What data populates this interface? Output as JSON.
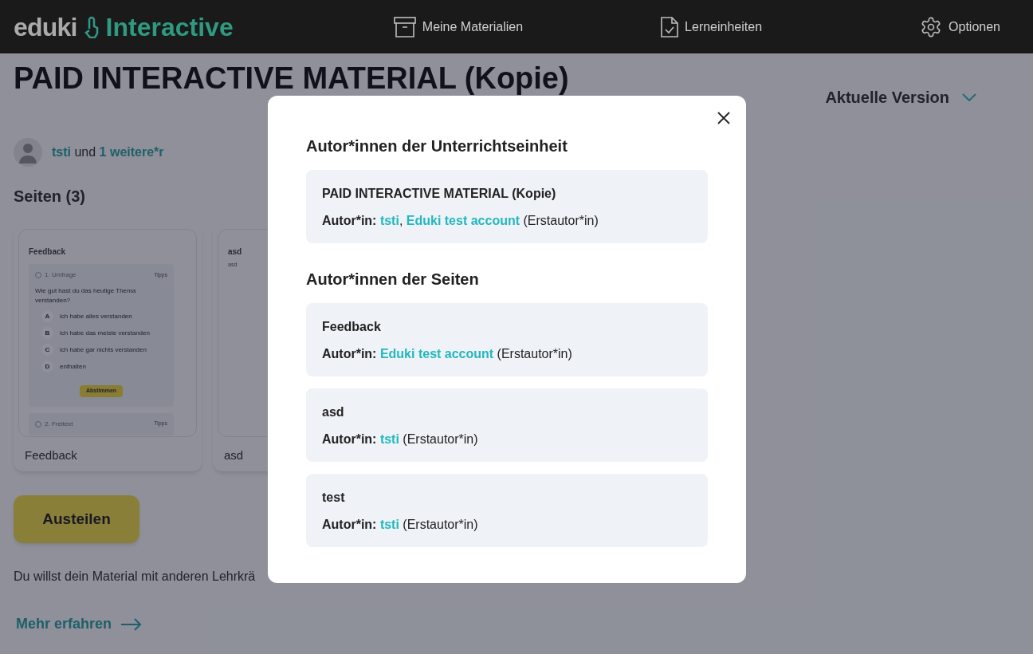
{
  "header": {
    "brand": "eduki",
    "product": "Interactive",
    "nav": [
      {
        "label": "Meine Materialien"
      },
      {
        "label": "Lerneinheiten"
      },
      {
        "label": "Optionen"
      }
    ]
  },
  "page": {
    "title": "PAID INTERACTIVE MATERIAL (Kopie)",
    "authors": {
      "first": "tsti",
      "joiner": "und",
      "more": "1 weitere*r"
    },
    "version_select": "Aktuelle Version",
    "pages_heading": "Seiten (3)",
    "pages": [
      {
        "caption": "Feedback",
        "preview": {
          "title": "Feedback",
          "blocks": [
            {
              "title": "1. Umfrage",
              "tips": "Tipps",
              "question": "Wie gut hast du das heutige Thema verstanden?",
              "options": [
                {
                  "letter": "A",
                  "text": "ich habe alles verstanden"
                },
                {
                  "letter": "B",
                  "text": "ich habe das meiste verstanden"
                },
                {
                  "letter": "C",
                  "text": "ich habe gar nichts verstanden"
                },
                {
                  "letter": "D",
                  "text": "enthalten"
                }
              ],
              "button": "Abstimmen"
            },
            {
              "title": "2. Freitext",
              "tips": "Tipps"
            }
          ]
        }
      },
      {
        "caption": "asd",
        "preview": {
          "title": "asd",
          "body": "asd"
        }
      }
    ],
    "share_button": "Austeilen",
    "share_text": "Du willst dein Material mit anderen Lehrkrä",
    "more_link": "Mehr erfahren"
  },
  "modal": {
    "sections": [
      {
        "heading": "Autor*innen der Unterrichtseinheit",
        "items": [
          {
            "title": "PAID INTERACTIVE MATERIAL (Kopie)",
            "label": "Autor*in:",
            "authors": [
              "tsti",
              "Eduki test account"
            ],
            "separator": ",",
            "note": "(Erstautor*in)"
          }
        ]
      },
      {
        "heading": "Autor*innen der Seiten",
        "items": [
          {
            "title": "Feedback",
            "label": "Autor*in:",
            "authors": [
              "Eduki test account"
            ],
            "note": "(Erstautor*in)"
          },
          {
            "title": "asd",
            "label": "Autor*in:",
            "authors": [
              "tsti"
            ],
            "note": "(Erstautor*in)"
          },
          {
            "title": "test",
            "label": "Autor*in:",
            "authors": [
              "tsti"
            ],
            "note": "(Erstautor*in)"
          }
        ]
      }
    ]
  }
}
